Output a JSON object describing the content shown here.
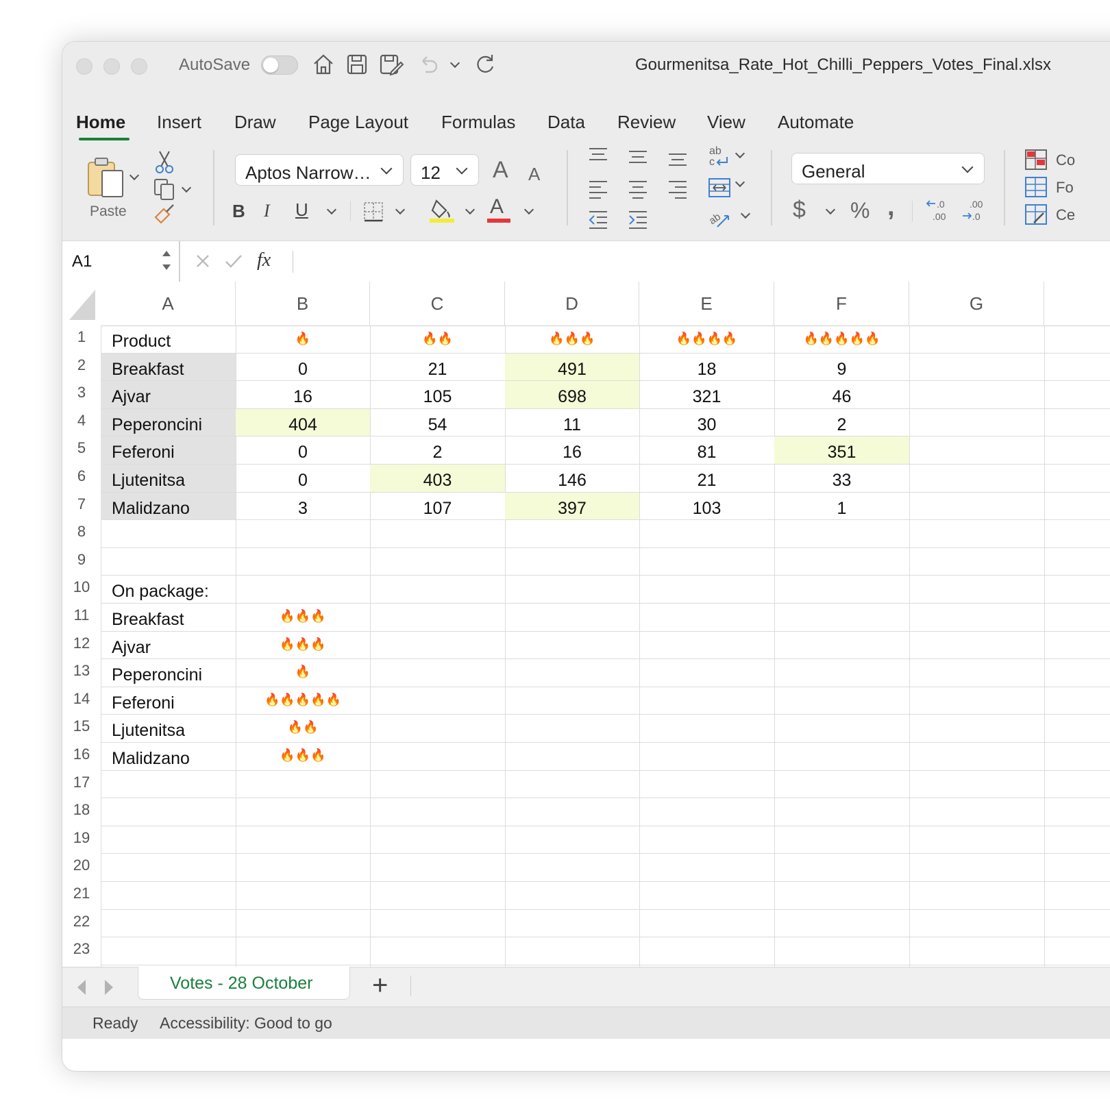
{
  "window": {
    "title": "Gourmenitsa_Rate_Hot_Chilli_Peppers_Votes_Final.xlsx",
    "autosave_label": "AutoSave"
  },
  "ribbon_tabs": [
    "Home",
    "Insert",
    "Draw",
    "Page Layout",
    "Formulas",
    "Data",
    "Review",
    "View",
    "Automate"
  ],
  "ribbon": {
    "paste_label": "Paste",
    "font_name": "Aptos Narrow…",
    "font_size": "12",
    "number_format": "General",
    "styles": [
      "Co",
      "Fo",
      "Ce"
    ],
    "bold": "B",
    "italic": "I",
    "underline": "U",
    "currency": "$",
    "percent": "%",
    "comma": ",",
    "dec_decrease": "←0 .00",
    "dec_increase": ".00 →.0",
    "font_increase": "A",
    "font_decrease": "A",
    "font_color_letter": "A",
    "wrap_letters": "ab c",
    "accent_color": "#1a7f3c"
  },
  "formula_bar": {
    "name_box": "A1",
    "fx": "fx",
    "value": ""
  },
  "columns": [
    "A",
    "B",
    "C",
    "D",
    "E",
    "F",
    "G"
  ],
  "rows": [
    "1",
    "2",
    "3",
    "4",
    "5",
    "6",
    "7",
    "8",
    "9",
    "10",
    "11",
    "12",
    "13",
    "14",
    "15",
    "16",
    "17",
    "18",
    "19",
    "20",
    "21",
    "22",
    "23"
  ],
  "table": {
    "header_label": "Product",
    "heat_headers": [
      "🔥",
      "🔥🔥",
      "🔥🔥🔥",
      "🔥🔥🔥🔥",
      "🔥🔥🔥🔥🔥"
    ],
    "products": [
      "Breakfast",
      "Ajvar",
      "Peperoncini",
      "Feferoni",
      "Ljutenitsa",
      "Malidzano"
    ],
    "votes": [
      [
        "0",
        "21",
        "491",
        "18",
        "9"
      ],
      [
        "16",
        "105",
        "698",
        "321",
        "46"
      ],
      [
        "404",
        "54",
        "11",
        "30",
        "2"
      ],
      [
        "0",
        "2",
        "16",
        "81",
        "351"
      ],
      [
        "0",
        "403",
        "146",
        "21",
        "33"
      ],
      [
        "3",
        "107",
        "397",
        "103",
        "1"
      ]
    ],
    "highlight_color": "#f5fbd6"
  },
  "package": {
    "label": "On package:",
    "items": [
      {
        "name": "Breakfast",
        "heat": "🔥🔥🔥"
      },
      {
        "name": "Ajvar",
        "heat": "🔥🔥🔥"
      },
      {
        "name": "Peperoncini",
        "heat": "🔥"
      },
      {
        "name": "Feferoni",
        "heat": "🔥🔥🔥🔥🔥"
      },
      {
        "name": "Ljutenitsa",
        "heat": "🔥🔥"
      },
      {
        "name": "Malidzano",
        "heat": "🔥🔥🔥"
      }
    ]
  },
  "sheet_tabs": [
    "Votes - 28 October"
  ],
  "add_sheet": "+",
  "status": {
    "ready": "Ready",
    "accessibility": "Accessibility: Good to go"
  }
}
